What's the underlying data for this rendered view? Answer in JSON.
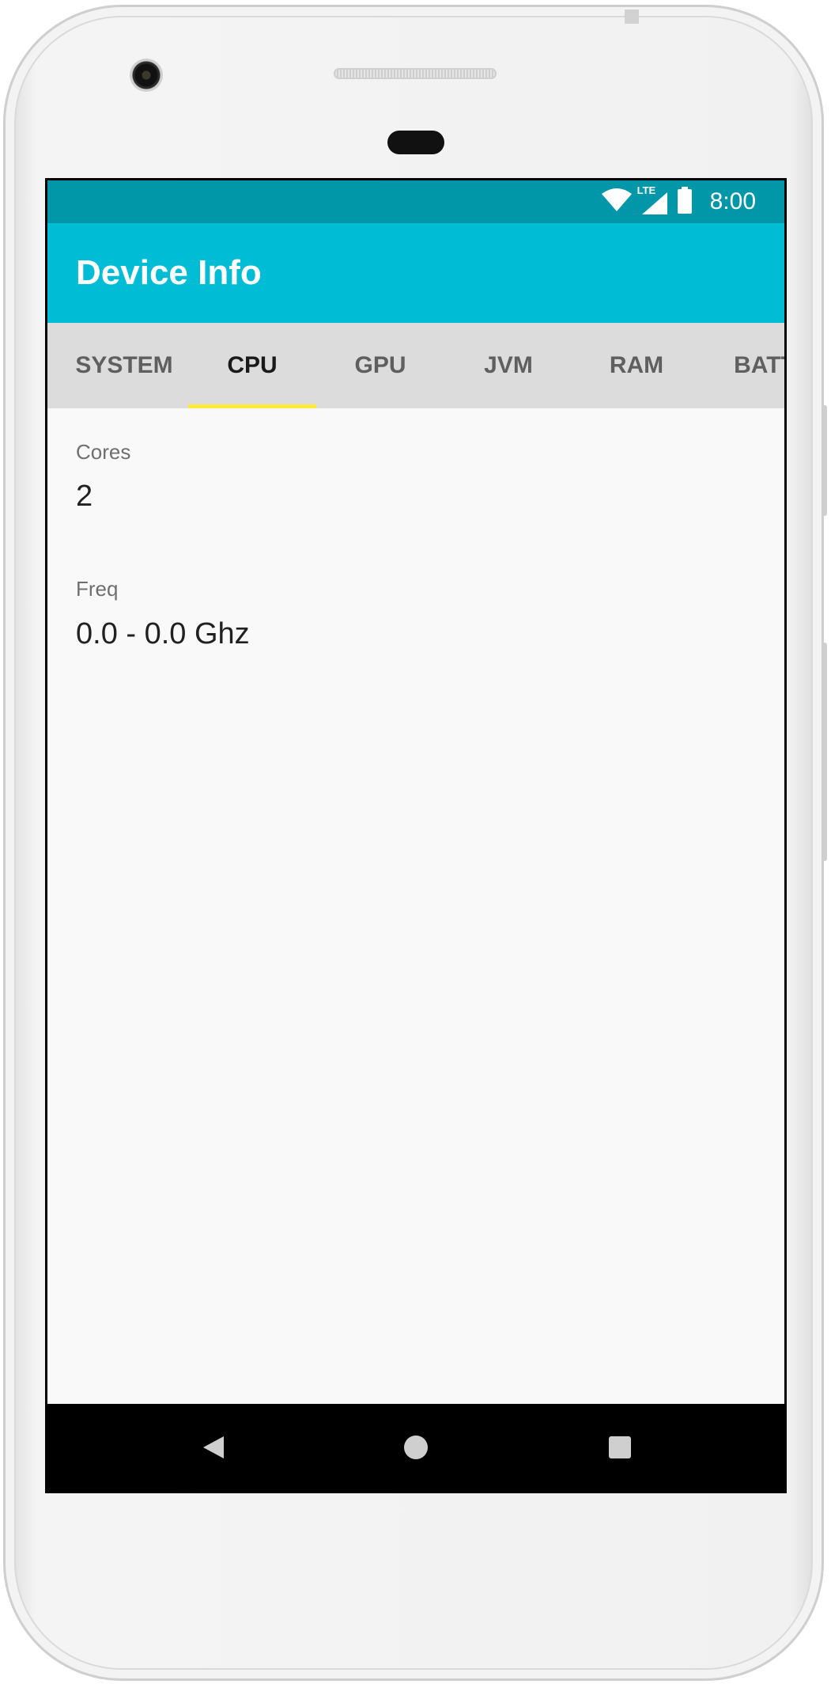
{
  "status_bar": {
    "time": "8:00",
    "network_label": "LTE",
    "icons": [
      "wifi-icon",
      "cell-signal-icon",
      "battery-icon"
    ]
  },
  "app_bar": {
    "title": "Device Info",
    "color": "#00bcd4"
  },
  "tabs": [
    {
      "label": "SYSTEM",
      "selected": false
    },
    {
      "label": "CPU",
      "selected": true
    },
    {
      "label": "GPU",
      "selected": false
    },
    {
      "label": "JVM",
      "selected": false
    },
    {
      "label": "RAM",
      "selected": false
    },
    {
      "label": "BATT",
      "selected": false
    }
  ],
  "tab_indicator_color": "#ffeb3b",
  "cpu": {
    "fields": [
      {
        "label": "Cores",
        "value": "2"
      },
      {
        "label": "Freq",
        "value": "0.0 - 0.0 Ghz"
      }
    ]
  },
  "nav_bar": {
    "buttons": [
      "back-icon",
      "home-icon",
      "recents-icon"
    ]
  }
}
